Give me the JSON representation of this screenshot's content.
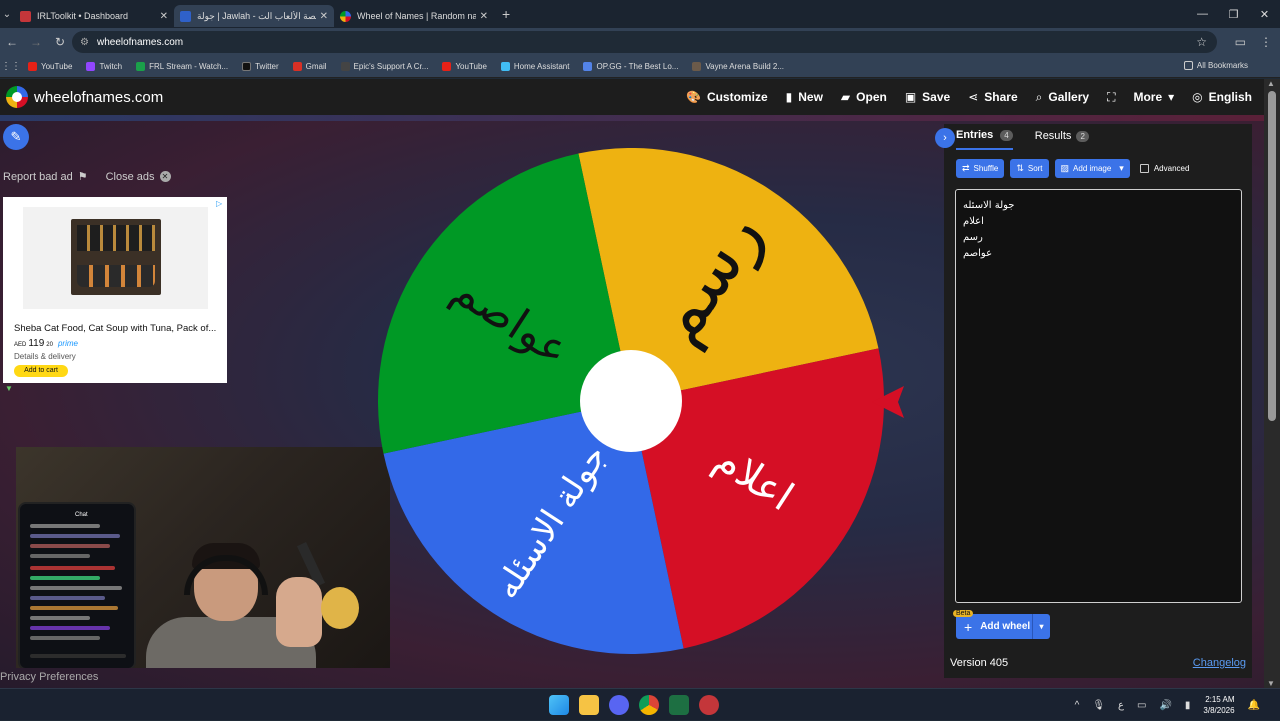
{
  "browser": {
    "tabs": [
      {
        "title": "IRLToolkit • Dashboard",
        "favicon_color": "#c4363a",
        "active": false
      },
      {
        "title": "جولة | Jawlah - منصة الألعاب الت...",
        "favicon_color": "#2f61c9",
        "active": true
      },
      {
        "title": "Wheel of Names | Random nam...",
        "favicon_color": "#3aa657",
        "active": false
      }
    ],
    "url": "wheelofnames.com",
    "bookmarks": [
      {
        "label": "YouTube",
        "color": "#e62117"
      },
      {
        "label": "Twitch",
        "color": "#9146ff"
      },
      {
        "label": "FRL Stream - Watch...",
        "color": "#1aa04a"
      },
      {
        "label": "Twitter",
        "color": "#111111"
      },
      {
        "label": "Gmail",
        "color": "#d93025"
      },
      {
        "label": "Epic's Support A Cr...",
        "color": "#444444"
      },
      {
        "label": "YouTube",
        "color": "#e62117"
      },
      {
        "label": "Home Assistant",
        "color": "#41bdf5"
      },
      {
        "label": "OP.GG - The Best Lo...",
        "color": "#5383e8"
      },
      {
        "label": "Vayne Arena Build 2...",
        "color": "#6b5a4a"
      }
    ],
    "all_bookmarks": "All Bookmarks"
  },
  "site": {
    "title": "wheelofnames.com",
    "menu": [
      {
        "label": "Customize",
        "icon": "palette-icon"
      },
      {
        "label": "New",
        "icon": "file-icon"
      },
      {
        "label": "Open",
        "icon": "folder-icon"
      },
      {
        "label": "Save",
        "icon": "save-icon"
      },
      {
        "label": "Share",
        "icon": "share-icon"
      },
      {
        "label": "Gallery",
        "icon": "search-icon"
      },
      {
        "label": "",
        "icon": "fullscreen-icon"
      },
      {
        "label": "More",
        "icon": "chevron-down-icon"
      },
      {
        "label": "English",
        "icon": "globe-icon"
      }
    ]
  },
  "ad_links": {
    "report": "Report bad ad",
    "close": "Close ads"
  },
  "ad": {
    "product": "Sheba Cat Food, Cat Soup with Tuna, Pack of...",
    "currency": "AED",
    "price_whole": "119",
    "price_fraction": "20",
    "prime": "prime",
    "delivery": "Details & delivery",
    "cta": "Add to cart"
  },
  "privacy": "Privacy Preferences",
  "wheel": {
    "colors": [
      "#eeb211",
      "#d50f25",
      "#3369e8",
      "#009925"
    ],
    "segments": [
      "رسم",
      "اعلام",
      "جولة الاسئله",
      "عواصم"
    ]
  },
  "panel": {
    "tabs": [
      {
        "label": "Entries",
        "count": "4"
      },
      {
        "label": "Results",
        "count": "2"
      }
    ],
    "buttons": {
      "shuffle": "Shuffle",
      "sort": "Sort",
      "add_image": "Add image",
      "advanced": "Advanced"
    },
    "entries": [
      "جولة الاسئله",
      "اعلام",
      "رسم",
      "عواصم"
    ],
    "beta": "Beta",
    "add_wheel": "Add wheel",
    "version": "Version 405",
    "changelog": "Changelog"
  },
  "taskbar": {
    "time": "2:15 AM",
    "date": "3/8/2026",
    "lang": "ع"
  },
  "stream_chat": {
    "title": "Chat"
  }
}
